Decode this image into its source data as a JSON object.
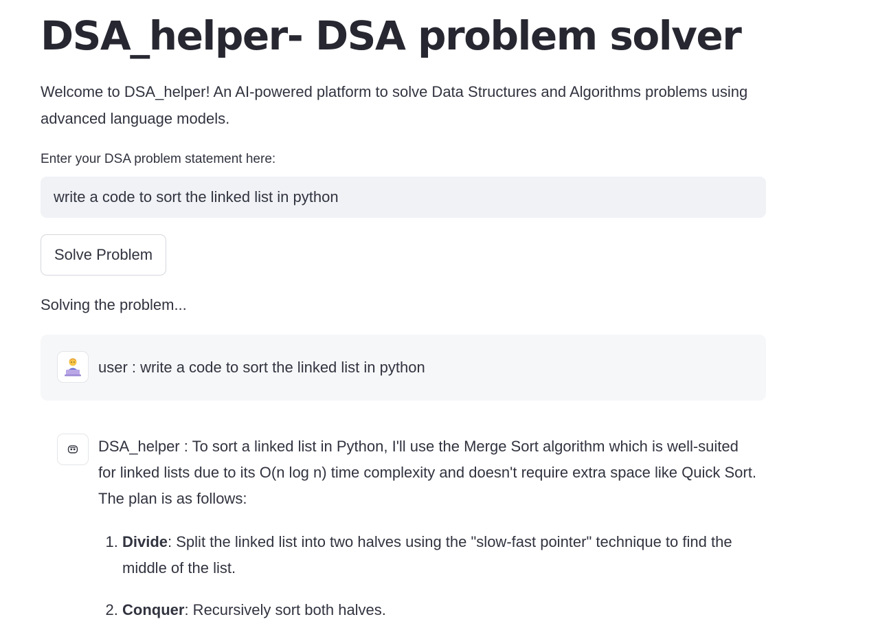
{
  "header": {
    "title": "DSA_helper- DSA problem solver",
    "intro": "Welcome to DSA_helper! An AI-powered platform to solve Data Structures and Algorithms problems using advanced language models."
  },
  "form": {
    "label": "Enter your DSA problem statement here:",
    "value": "write a code to sort the linked list in python",
    "button_label": "Solve Problem"
  },
  "status_text": "Solving the problem...",
  "chat": {
    "user_message": {
      "avatar_icon": "technologist-emoji-icon",
      "text": "user : write a code to sort the linked list in python"
    },
    "assistant_message": {
      "avatar_icon": "robot-face-icon",
      "intro": "DSA_helper : To sort a linked list in Python, I'll use the Merge Sort algorithm which is well-suited for linked lists due to its O(n log n) time complexity and doesn't require extra space like Quick Sort. The plan is as follows:",
      "steps": [
        {
          "term": "Divide",
          "text": ": Split the linked list into two halves using the \"slow-fast pointer\" technique to find the middle of the list."
        },
        {
          "term": "Conquer",
          "text": ": Recursively sort both halves."
        }
      ]
    }
  }
}
